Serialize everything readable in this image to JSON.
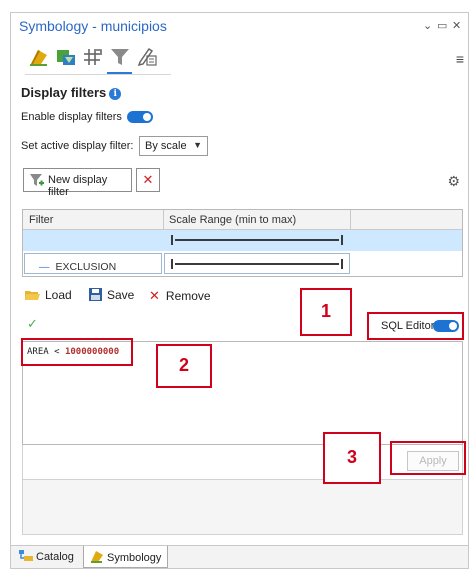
{
  "window": {
    "title": "Symbology - municipios",
    "minimize_glyph": "⌄",
    "restore_glyph": "▭",
    "close_glyph": "✕",
    "menu_glyph": "≡"
  },
  "tabs": [
    {
      "icon": "primary-symbology-icon",
      "active": false
    },
    {
      "icon": "vary-symbology-icon",
      "active": false
    },
    {
      "icon": "symbol-layer-drawing-icon",
      "active": false
    },
    {
      "icon": "display-filter-icon",
      "active": true
    },
    {
      "icon": "label-classes-icon",
      "active": false
    }
  ],
  "display_filters": {
    "title": "Display filters",
    "info_glyph": "i",
    "enable_label": "Enable display filters",
    "enabled": true,
    "active_filter_label": "Set active display filter:",
    "active_filter_value": "By scale",
    "new_filter_label": "New display filter",
    "delete_glyph": "✕",
    "settings_glyph": "⚙"
  },
  "grid": {
    "columns": [
      "Filter",
      "Scale Range (min to max)",
      ""
    ],
    "rows": [
      {
        "name": "",
        "selected": true
      },
      {
        "name": "EXCLUSION",
        "dash": "—",
        "selected": false
      }
    ]
  },
  "editor_toolbar": {
    "load_label": "Load",
    "save_label": "Save",
    "remove_glyph": "✕",
    "remove_label": "Remove",
    "valid_glyph": "✓",
    "sql_editor_label": "SQL Editor",
    "sql_editor_on": true
  },
  "sql": {
    "field": "AREA",
    "operator": "<",
    "value": "1000000000"
  },
  "apply_label": "Apply",
  "bottom_tabs": [
    {
      "label": "Catalog",
      "active": false
    },
    {
      "label": "Symbology",
      "active": true
    }
  ],
  "annotations": [
    "1",
    "2",
    "3"
  ],
  "colors": {
    "accent": "#2b79d6",
    "title": "#2b68c5",
    "selected_row": "#cde8ff",
    "annotation": "#d0021b",
    "delete": "#d41d1d",
    "sql_number": "#b0312f"
  }
}
